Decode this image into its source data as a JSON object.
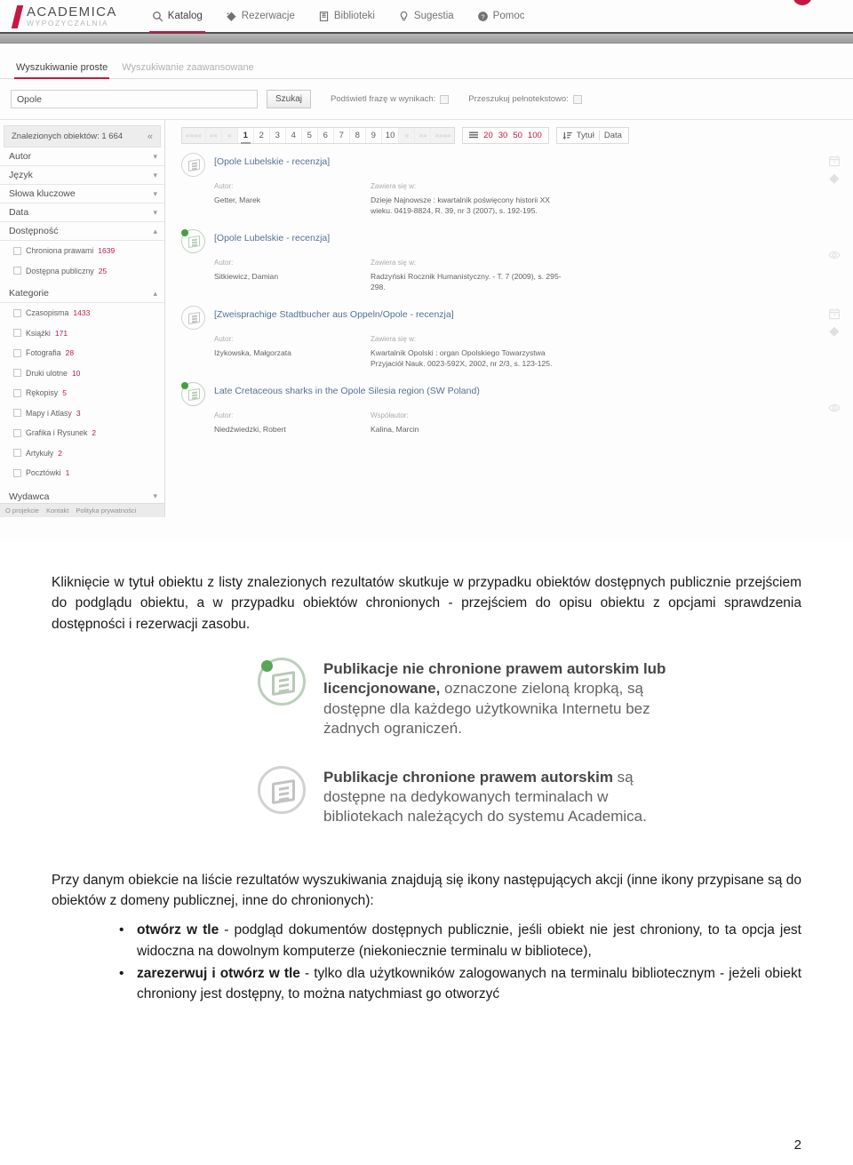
{
  "app": {
    "brand_top": "ACADEMICA",
    "brand_sub": "WYPOZYCZALNIA",
    "nav": [
      {
        "label": "Katalog",
        "icon": "search-icon"
      },
      {
        "label": "Rezerwacje",
        "icon": "tag-icon"
      },
      {
        "label": "Biblioteki",
        "icon": "building-icon"
      },
      {
        "label": "Sugestia",
        "icon": "bulb-icon"
      },
      {
        "label": "Pomoc",
        "icon": "question-circle-icon"
      }
    ],
    "accent_color": "#c2103c"
  },
  "search": {
    "tabs": [
      {
        "label": "Wyszukiwanie proste",
        "active": true
      },
      {
        "label": "Wyszukiwanie zaawansowane",
        "active": false
      }
    ],
    "query_value": "Opole",
    "placeholder": "Opole",
    "button_label": "Szukaj",
    "options": [
      {
        "label": "Podświetl frazę w wynikach:",
        "checked": false
      },
      {
        "label": "Przeszukuj pełnotekstowo:",
        "checked": false
      }
    ]
  },
  "sidebar": {
    "found_label": "Znalezionych obiektów: 1 664",
    "collapse_icon": "double-chevron-left-icon",
    "facets": [
      {
        "label": "Autor",
        "caret": "chevron-down-icon",
        "open": false
      },
      {
        "label": "Język",
        "caret": "chevron-down-icon",
        "open": false
      },
      {
        "label": "Słowa kluczowe",
        "caret": "chevron-down-icon",
        "open": false
      },
      {
        "label": "Data",
        "caret": "chevron-down-icon",
        "open": false
      }
    ],
    "availability": {
      "label": "Dostępność",
      "caret": "chevron-up-icon",
      "options": [
        {
          "label": "Chroniona prawami",
          "count": "1639"
        },
        {
          "label": "Dostępna publiczny",
          "count": "25"
        }
      ]
    },
    "categories": {
      "label": "Kategorie",
      "caret": "chevron-up-icon",
      "options": [
        {
          "label": "Czasopisma",
          "count": "1433"
        },
        {
          "label": "Książki",
          "count": "171"
        },
        {
          "label": "Fotografia",
          "count": "28"
        },
        {
          "label": "Druki ulotne",
          "count": "10"
        },
        {
          "label": "Rękopisy",
          "count": "5"
        },
        {
          "label": "Mapy i Atlasy",
          "count": "3"
        },
        {
          "label": "Grafika i Rysunek",
          "count": "2"
        },
        {
          "label": "Artykuły",
          "count": "2"
        },
        {
          "label": "Pocztówki",
          "count": "1"
        }
      ]
    },
    "publisher": {
      "label": "Wydawca",
      "caret": "chevron-down-icon"
    },
    "footer_links": [
      "O projekcie",
      "Kontakt",
      "Polityka prywatności"
    ]
  },
  "pager": {
    "first": "««««",
    "prev_group": "««",
    "prev": "«",
    "pages": [
      "1",
      "2",
      "3",
      "4",
      "5",
      "6",
      "7",
      "8",
      "9",
      "10"
    ],
    "current": "1",
    "next": "»",
    "next_group": "»»",
    "last": "»»»»",
    "per_page": [
      "20",
      "30",
      "50",
      "100"
    ],
    "per_page_icon": "list-icon",
    "sort_icon": "sort-icon",
    "sort_options": [
      "Tytuł",
      "Data"
    ]
  },
  "results": [
    {
      "title": "[Opole Lubelskie - recenzja]",
      "protected": true,
      "author_label": "Autor:",
      "author": "Getter, Marek",
      "contains_label": "Zawiera się w:",
      "contains": "Dzieje Najnowsze : kwartalnik poświęcony historii XX wieku. 0419-8824, R. 39, nr 3 (2007), s. 192-195.",
      "actions": [
        "calendar-question-icon",
        "tag-icon"
      ]
    },
    {
      "title": "[Opole Lubelskie - recenzja]",
      "protected": false,
      "author_label": "Autor:",
      "author": "Sitkiewicz, Damian",
      "contains_label": "Zawiera się w:",
      "contains": "Radzyński Rocznik Humanistyczny. - T. 7 (2009), s. 295-298.",
      "actions": [
        "eye-icon"
      ]
    },
    {
      "title": "[Zweisprachige Stadtbucher aus Oppeln/Opole - recenzja]",
      "protected": true,
      "author_label": "Autor:",
      "author": "Iżykowska, Małgorzata",
      "contains_label": "Zawiera się w:",
      "contains": "Kwartalnik Opolski : organ Opolskiego Towarzystwa Przyjaciół Nauk. 0023-592X, 2002, nr 2/3, s. 123-125.",
      "actions": [
        "calendar-question-icon",
        "tag-icon"
      ]
    },
    {
      "title": "Late Cretaceous sharks in the Opole Silesia region (SW Poland)",
      "protected": false,
      "author_label": "Autor:",
      "author": "Niedźwiedzki, Robert",
      "coauthor_label": "Współautor:",
      "coauthor": "Kalina, Marcin",
      "actions": [
        "eye-icon"
      ]
    }
  ],
  "document": {
    "intro_paragraph": "Kliknięcie w tytuł obiektu z listy znalezionych rezultatów skutkuje w przypadku obiektów dostępnych publicznie przejściem do podglądu obiektu, a w przypadku obiektów chronionych - przejściem do opisu obiektu z opcjami sprawdzenia dostępności i rezerwacji zasobu.",
    "legend": [
      {
        "type": "public",
        "bold": "Publikacje nie chronione prawem autorskim lub licencjonowane,",
        "rest": " oznaczone zieloną kropką, są dostępne dla każdego użytkownika Internetu bez żadnych ograniczeń."
      },
      {
        "type": "protected",
        "bold": "Publikacje chronione prawem autorskim",
        "rest": " są dostępne na dedykowanych terminalach w bibliotekach należących do systemu Academica."
      }
    ],
    "actions_paragraph": "Przy danym obiekcie na liście rezultatów wyszukiwania znajdują się ikony następujących akcji (inne ikony przypisane są do obiektów z domeny publicznej, inne do chronionych):",
    "bullets": [
      {
        "bold": "otwórz w tle",
        "rest": " - podgląd dokumentów dostępnych publicznie, jeśli obiekt nie jest chroniony, to ta opcja jest widoczna na dowolnym komputerze (niekoniecznie terminalu w bibliotece),"
      },
      {
        "bold": "zarezerwuj i otwórz w tle",
        "rest": " - tylko dla użytkowników zalogowanych na terminalu bibliotecznym - jeżeli obiekt chroniony jest dostępny, to można natychmiast go otworzyć"
      }
    ],
    "page_number": "2"
  }
}
